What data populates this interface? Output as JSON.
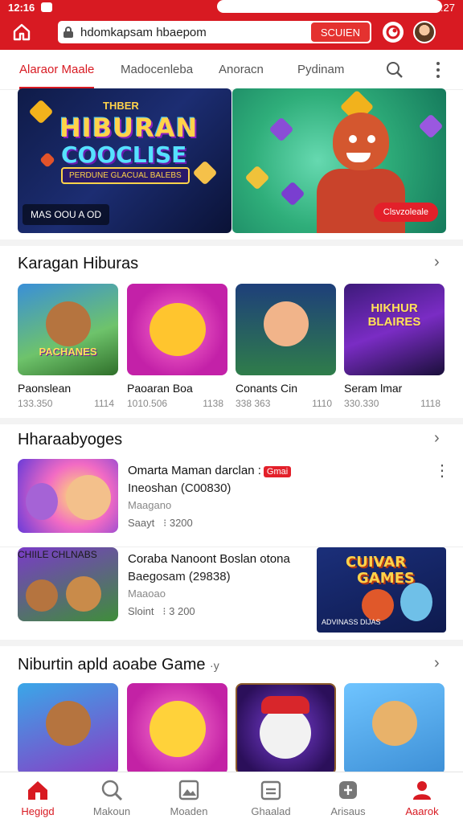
{
  "status_bar": {
    "time": "12:16",
    "right_time": "12:27"
  },
  "app_bar": {
    "search_text": "hdomkapsam hbaepom",
    "search_button": "SCUIEN"
  },
  "tabs": [
    {
      "label": "Alaraor Maale",
      "active": true
    },
    {
      "label": "Madocenleba"
    },
    {
      "label": "Anoracn"
    },
    {
      "label": "Pydinam"
    }
  ],
  "banners": {
    "left": {
      "small_text": "THBER",
      "title_line1": "HIBURAN",
      "title_line2": "COOCLISE",
      "ribbon": "PERDUNE GLACUAL BALEBS",
      "chip": "MAS OOU A OD"
    },
    "right": {
      "cta": "Clsvzoleale"
    }
  },
  "sections": {
    "s1": {
      "title": "Karagan Hiburas"
    },
    "s2": {
      "title": "Hharaabyoges"
    },
    "s3": {
      "title": "Niburtin apld aoabe Game",
      "suffix": "·y"
    }
  },
  "row1": [
    {
      "name": "Paonslean",
      "count": "133.350",
      "rating": "1114",
      "thumb_label": "PACHANES"
    },
    {
      "name": "Paoaran Boa",
      "count": "1010.506",
      "rating": "1138",
      "thumb_label": ""
    },
    {
      "name": "Conants Cin",
      "count": "338 363",
      "rating": "1110",
      "thumb_label": ""
    },
    {
      "name": "Seram lmar",
      "count": "330.330",
      "rating": "1118",
      "thumb_label": "HIKHUR BLAIRES"
    }
  ],
  "list": [
    {
      "line1": "Omarta Maman darclan :",
      "badge": "Gmai",
      "line2": "Ineoshan (C00830)",
      "line3": "Maagano",
      "line4_label": "Saayt",
      "line4_value": "3200"
    },
    {
      "line1": "Coraba Nanoont Boslan otona",
      "line2": "Baegosam (29838)",
      "line3": "Maaoao",
      "line4_label": "Sloint",
      "line4_value": "3 200",
      "thumb_label": "CHIILE CHLNABS",
      "ad_title1": "CUIVAR",
      "ad_title2": "GAMES",
      "ad_sub": "ADVINASS DIJAS"
    }
  ],
  "row3": [
    {
      "name": ""
    },
    {
      "name": ""
    },
    {
      "name": ""
    },
    {
      "name": ""
    }
  ],
  "bottom_nav": [
    {
      "label": "Hegigd",
      "icon": "home-icon",
      "active": true
    },
    {
      "label": "Makoun",
      "icon": "search-icon"
    },
    {
      "label": "Moaden",
      "icon": "gallery-icon"
    },
    {
      "label": "Ghaalad",
      "icon": "calendar-icon"
    },
    {
      "label": "Arisaus",
      "icon": "plugin-icon"
    },
    {
      "label": "Aaarok",
      "icon": "profile-icon"
    }
  ],
  "colors": {
    "brand": "#d81a22",
    "accent": "#e4322f"
  }
}
